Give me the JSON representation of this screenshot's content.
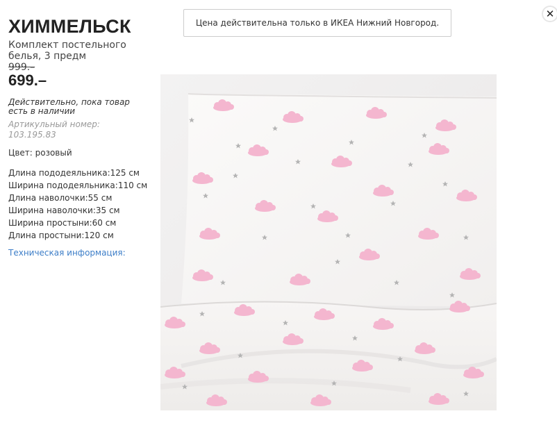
{
  "product": {
    "name": "ХИММЕЛЬСК",
    "description": "Комплект постельного белья, 3 предм",
    "old_price": "999.–",
    "price": "699.–",
    "availability": "Действительно, пока товар есть в наличии",
    "article": "Артикульный номер: 103.195.83",
    "color": "Цвет: розовый",
    "dimensions": [
      "Длина пододеяльника:125 см",
      "Ширина пододеяльника:110 см",
      "Длина наволочки:55 см",
      "Ширина наволочки:35 см",
      "Ширина простыни:60 см",
      "Длина простыни:120 см"
    ],
    "tech_info_link": "Техническая информация:"
  },
  "notice": "Цена действительна только в ИКЕА Нижний Новгород.",
  "close_icon": "close-icon",
  "colors": {
    "link": "#3d7ec8",
    "cloud_pink": "#f4b6cf",
    "star_grey": "#b4b4b4"
  }
}
